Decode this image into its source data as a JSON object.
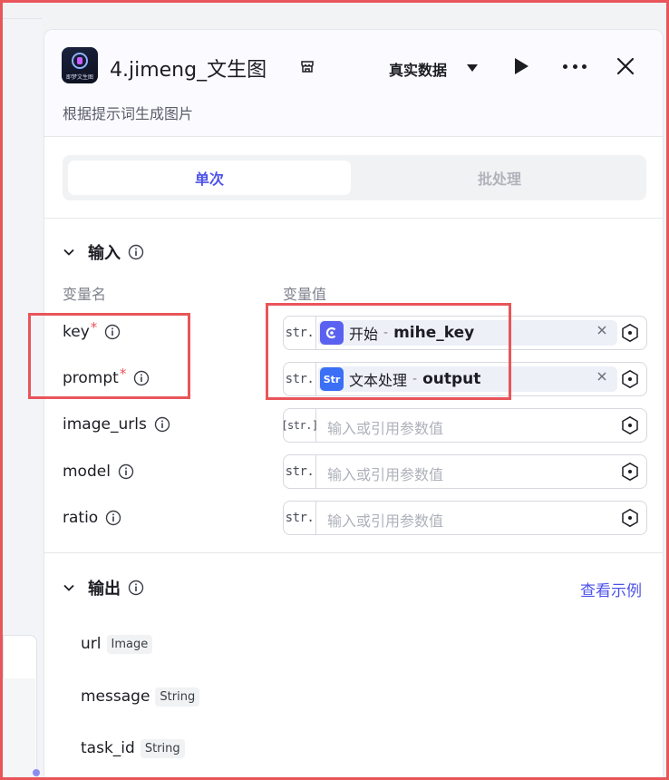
{
  "node": {
    "title": "4.jimeng_文生图",
    "icon_label": "即梦文生图",
    "description": "根据提示词生成图片",
    "data_mode": "真实数据"
  },
  "tabs": [
    {
      "label": "单次",
      "active": true
    },
    {
      "label": "批处理",
      "active": false
    }
  ],
  "input": {
    "title": "输入",
    "col_name": "变量名",
    "col_value": "变量值",
    "rows": [
      {
        "name": "key",
        "required": true,
        "type": "str.",
        "ref_icon": "start-node-icon",
        "ref_node": "开始",
        "ref_field": "mihe_key"
      },
      {
        "name": "prompt",
        "required": true,
        "type": "str.",
        "ref_icon": "text-process-icon",
        "ref_icon_text": "Str",
        "ref_node": "文本处理",
        "ref_field": "output"
      },
      {
        "name": "image_urls",
        "required": false,
        "type": "[str.]",
        "placeholder": "输入或引用参数值"
      },
      {
        "name": "model",
        "required": false,
        "type": "str.",
        "placeholder": "输入或引用参数值"
      },
      {
        "name": "ratio",
        "required": false,
        "type": "str.",
        "placeholder": "输入或引用参数值"
      }
    ]
  },
  "output": {
    "title": "输出",
    "example_link": "查看示例",
    "fields": [
      {
        "name": "url",
        "type": "Image"
      },
      {
        "name": "message",
        "type": "String"
      },
      {
        "name": "task_id",
        "type": "String"
      }
    ]
  },
  "colors": {
    "accent": "#4d53e8",
    "required": "#e8555a",
    "highlight": "#e8555a"
  }
}
